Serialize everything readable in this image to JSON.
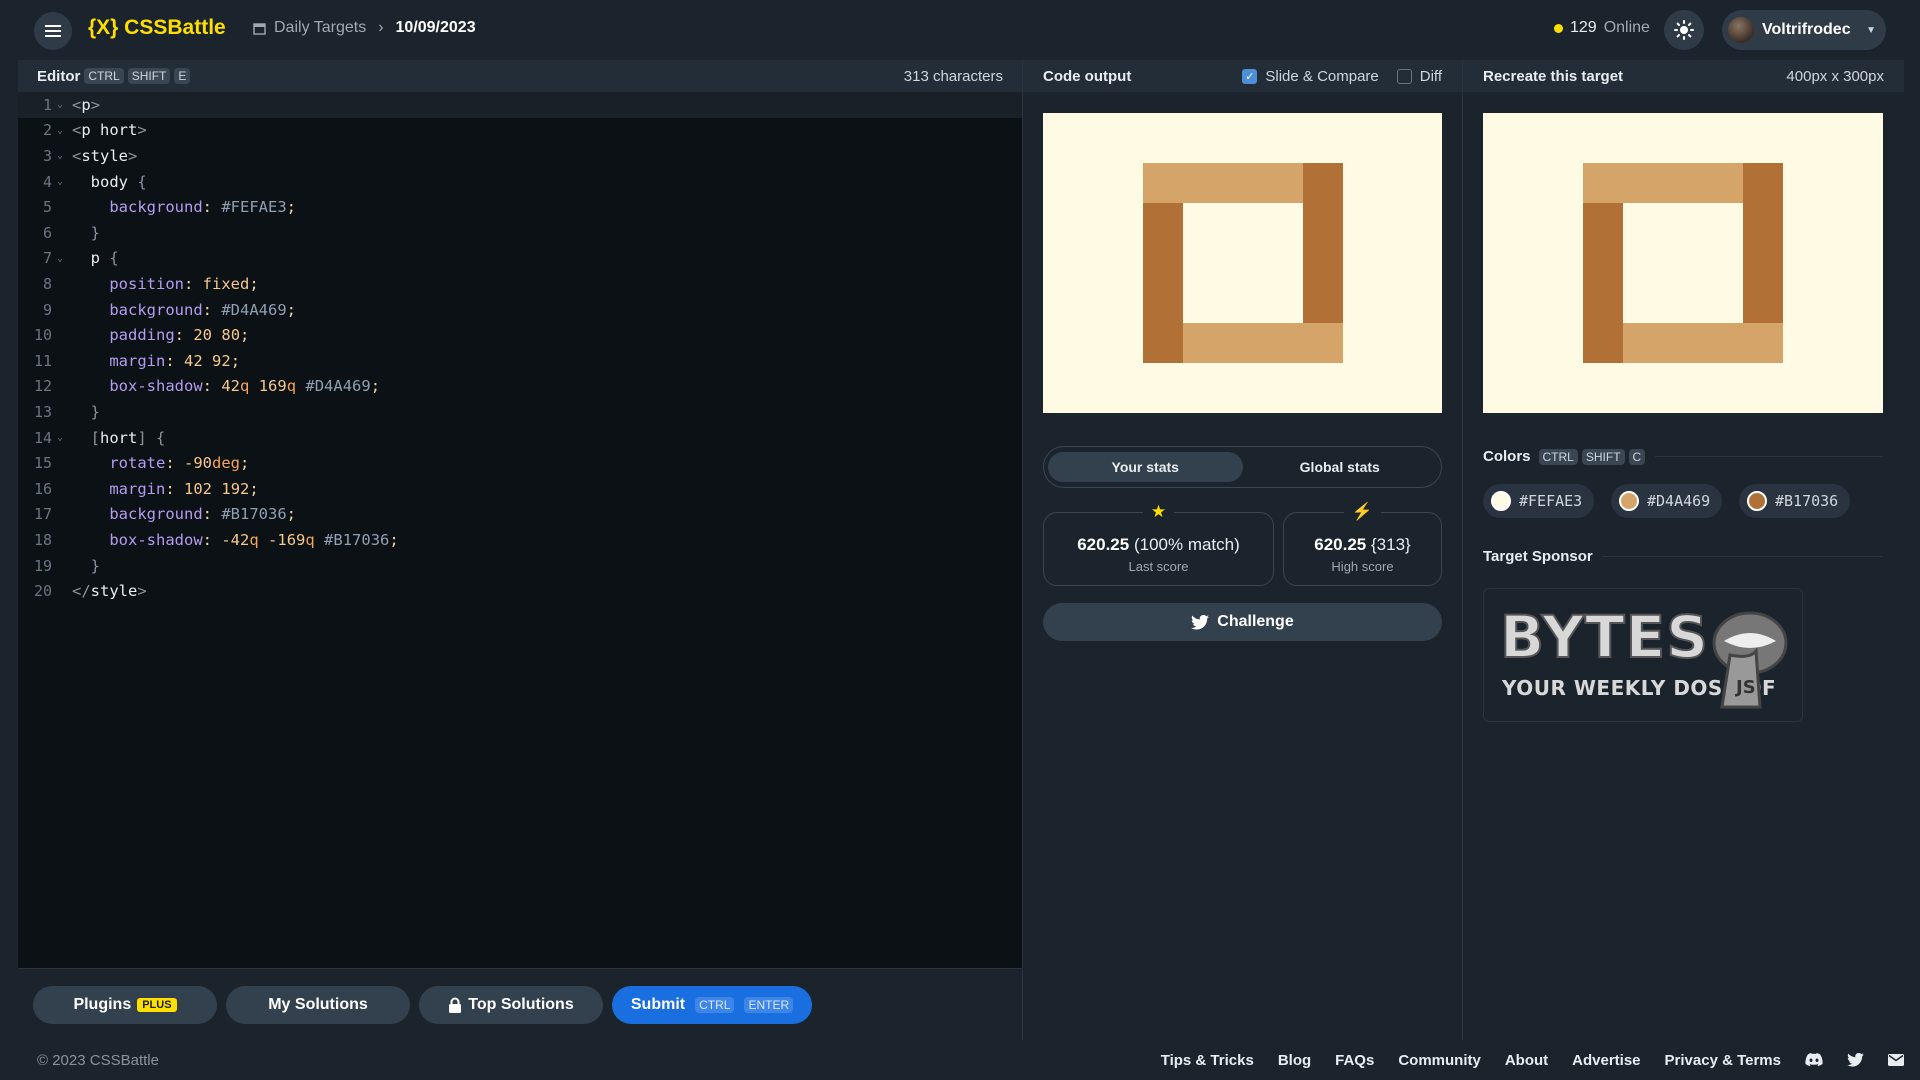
{
  "header": {
    "logo_text": "{X} CSSBattle",
    "breadcrumb_section": "Daily Targets",
    "breadcrumb_date": "10/09/2023",
    "online_count": "129",
    "online_label": "Online",
    "username": "Voltrifrodec"
  },
  "editor": {
    "title": "Editor",
    "shortcut": [
      "CTRL",
      "SHIFT",
      "E"
    ],
    "char_count": "313 characters",
    "lines": [
      "<p>",
      "<p hort>",
      "<style>",
      "  body {",
      "    background: #FEFAE3;",
      "  }",
      "  p {",
      "    position: fixed;",
      "    background: #D4A469;",
      "    padding: 20 80;",
      "    margin: 42 92;",
      "    box-shadow: 42q 169q #D4A469;",
      "  }",
      "  [hort] {",
      "    rotate: -90deg;",
      "    margin: 102 192;",
      "    background: #B17036;",
      "    box-shadow: -42q -169q #B17036;",
      "  }",
      "</style>"
    ]
  },
  "bottom": {
    "plugins": "Plugins",
    "plus": "PLUS",
    "my_solutions": "My Solutions",
    "top_solutions": "Top Solutions",
    "submit": "Submit",
    "submit_kbd": [
      "CTRL",
      "ENTER"
    ]
  },
  "output": {
    "title": "Code output",
    "slide_compare": "Slide & Compare",
    "slide_compare_checked": true,
    "diff": "Diff",
    "diff_checked": false
  },
  "target": {
    "title": "Recreate this target",
    "size": "400px x 300px"
  },
  "stats": {
    "tab_yours": "Your stats",
    "tab_global": "Global stats",
    "last_score": "620.25",
    "last_match": "(100% match)",
    "last_caption": "Last score",
    "high_score": "620.25",
    "high_chars": "{313}",
    "high_caption": "High score",
    "challenge": "Challenge"
  },
  "colors": {
    "title": "Colors",
    "shortcut": [
      "CTRL",
      "SHIFT",
      "C"
    ],
    "list": [
      "#FEFAE3",
      "#D4A469",
      "#B17036"
    ]
  },
  "sponsor": {
    "title": "Target Sponsor",
    "logo_main": "BYTES",
    "logo_sub": "YOUR WEEKLY DOSE OF"
  },
  "footer": {
    "copyright": "© 2023 CSSBattle",
    "links": [
      "Tips & Tricks",
      "Blog",
      "FAQs",
      "Community",
      "About",
      "Advertise",
      "Privacy & Terms"
    ]
  }
}
